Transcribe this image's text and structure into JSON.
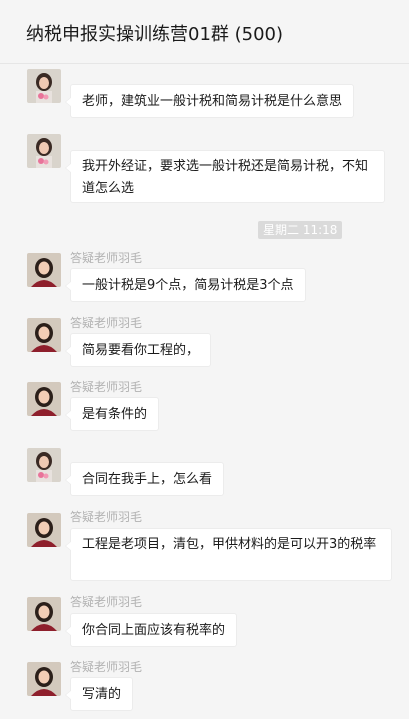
{
  "header": {
    "title": "纳税申报实操训练营01群 (500)"
  },
  "timestamp": "星期二 11:18",
  "messages": [
    {
      "avatar": "avatar-student",
      "text": "老师，建筑业一般计税和简易计税是什么意思"
    },
    {
      "avatar": "avatar-student",
      "text": "我开外经证，要求选一般计税还是简易计税，不知道怎么选"
    },
    {
      "avatar": "avatar-teacher",
      "sender": "答疑老师羽毛",
      "text": "一般计税是9个点，简易计税是3个点"
    },
    {
      "avatar": "avatar-teacher",
      "sender": "答疑老师羽毛",
      "text": "简易要看你工程的，"
    },
    {
      "avatar": "avatar-teacher",
      "sender": "答疑老师羽毛",
      "text": "是有条件的"
    },
    {
      "avatar": "avatar-student",
      "text": "合同在我手上，怎么看"
    },
    {
      "avatar": "avatar-teacher",
      "sender": "答疑老师羽毛",
      "text": "工程是老项目，清包，甲供材料的是可以开3的税率"
    },
    {
      "avatar": "avatar-teacher",
      "sender": "答疑老师羽毛",
      "text": "你合同上面应该有税率的"
    },
    {
      "avatar": "avatar-teacher",
      "sender": "答疑老师羽毛",
      "text": "写清的"
    }
  ]
}
